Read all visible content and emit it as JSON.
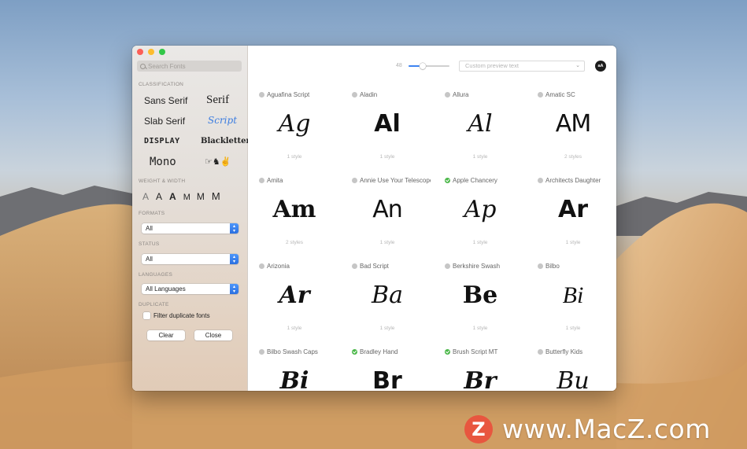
{
  "sidebar": {
    "search_placeholder": "Search Fonts",
    "classification_title": "CLASSIFICATION",
    "classes": [
      "Sans Serif",
      "Serif",
      "Slab Serif",
      "Script",
      "DISPLAY",
      "Blackletter",
      "Mono",
      "☞♞✌"
    ],
    "weight_title": "WEIGHT & WIDTH",
    "weights": [
      "A",
      "A",
      "A",
      "M",
      "M",
      "M"
    ],
    "formats_title": "FORMATS",
    "formats_value": "All",
    "status_title": "STATUS",
    "status_value": "All",
    "languages_title": "LANGUAGES",
    "languages_value": "All Languages",
    "duplicate_title": "DUPLICATE",
    "duplicate_label": "Filter duplicate fonts",
    "clear_label": "Clear",
    "close_label": "Close"
  },
  "toolbar": {
    "size_value": "48",
    "slider_fraction": 0.35,
    "preview_placeholder": "Custom preview text",
    "aa_label": "aA"
  },
  "fonts": [
    {
      "name": "Aguafina Script",
      "sample": "Ag",
      "styles": "1 style",
      "active": false
    },
    {
      "name": "Aladin",
      "sample": "Al",
      "styles": "1 style",
      "active": false
    },
    {
      "name": "Allura",
      "sample": "Al",
      "styles": "1 style",
      "active": false
    },
    {
      "name": "Amatic SC",
      "sample": "AM",
      "styles": "2 styles",
      "active": false
    },
    {
      "name": "Amita",
      "sample": "Am",
      "styles": "2 styles",
      "active": false
    },
    {
      "name": "Annie Use Your Telescope",
      "sample": "An",
      "styles": "1 style",
      "active": false
    },
    {
      "name": "Apple Chancery",
      "sample": "Ap",
      "styles": "1 style",
      "active": true
    },
    {
      "name": "Architects Daughter",
      "sample": "Ar",
      "styles": "1 style",
      "active": false
    },
    {
      "name": "Arizonia",
      "sample": "Ar",
      "styles": "1 style",
      "active": false
    },
    {
      "name": "Bad Script",
      "sample": "Ba",
      "styles": "1 style",
      "active": false
    },
    {
      "name": "Berkshire Swash",
      "sample": "Be",
      "styles": "1 style",
      "active": false
    },
    {
      "name": "Bilbo",
      "sample": "Bi",
      "styles": "1 style",
      "active": false
    },
    {
      "name": "Bilbo Swash Caps",
      "sample": "Bi",
      "styles": "",
      "active": false
    },
    {
      "name": "Bradley Hand",
      "sample": "Br",
      "styles": "",
      "active": true
    },
    {
      "name": "Brush Script MT",
      "sample": "Br",
      "styles": "",
      "active": true
    },
    {
      "name": "Butterfly Kids",
      "sample": "Bu",
      "styles": "",
      "active": false
    }
  ],
  "watermark": {
    "logo": "Z",
    "text": "www.MacZ.com"
  }
}
